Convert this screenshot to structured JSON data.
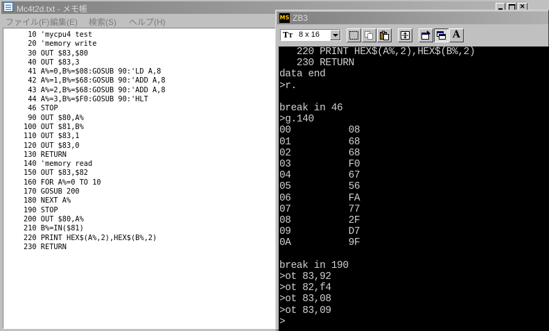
{
  "notepad": {
    "title": "Mc4t2d.txt - メモ帳",
    "menu": {
      "file": "ファイル(F)",
      "edit": "編集(E)",
      "search": "検索(S)",
      "help": "ヘルプ(H)"
    },
    "lines": [
      "10 'mycpu4 test",
      "20 'memory write",
      "30 OUT $83,$80",
      "40 OUT $83,3",
      "41 A%=0,B%=$08:GOSUB 90:'LD A,8",
      "42 A%=1,B%=$68:GOSUB 90:'ADD A,8",
      "43 A%=2,B%=$68:GOSUB 90:'ADD A,8",
      "44 A%=3,B%=$F0:GOSUB 90:'HLT",
      "46 STOP",
      "90 OUT $80,A%",
      "100 OUT $81,B%",
      "110 OUT $83,1",
      "120 OUT $83,0",
      "130 RETURN",
      "140 'memory read",
      "150 OUT $83,$82",
      "160 FOR A%=0 TO 10",
      "170 GOSUB 200",
      "180 NEXT A%",
      "190 STOP",
      "200 OUT $80,A%",
      "210 B%=IN($81)",
      "220 PRINT HEX$(A%,2),HEX$(B%,2)",
      "230 RETURN"
    ]
  },
  "zb3": {
    "title": "ZB3",
    "font_setting": "8 x 16",
    "console_lines": [
      "   220 PRINT HEX$(A%,2),HEX$(B%,2)",
      "   230 RETURN",
      "data end",
      ">r.",
      "",
      "break in 46",
      ">g.140",
      "00          08",
      "01          68",
      "02          68",
      "03          F0",
      "04          67",
      "05          56",
      "06          FA",
      "07          77",
      "08          2F",
      "09          D7",
      "0A          9F",
      "",
      "break in 190",
      ">ot 83,92",
      ">ot 82,f4",
      ">ot 83,08",
      ">ot 83,09",
      ">"
    ]
  }
}
